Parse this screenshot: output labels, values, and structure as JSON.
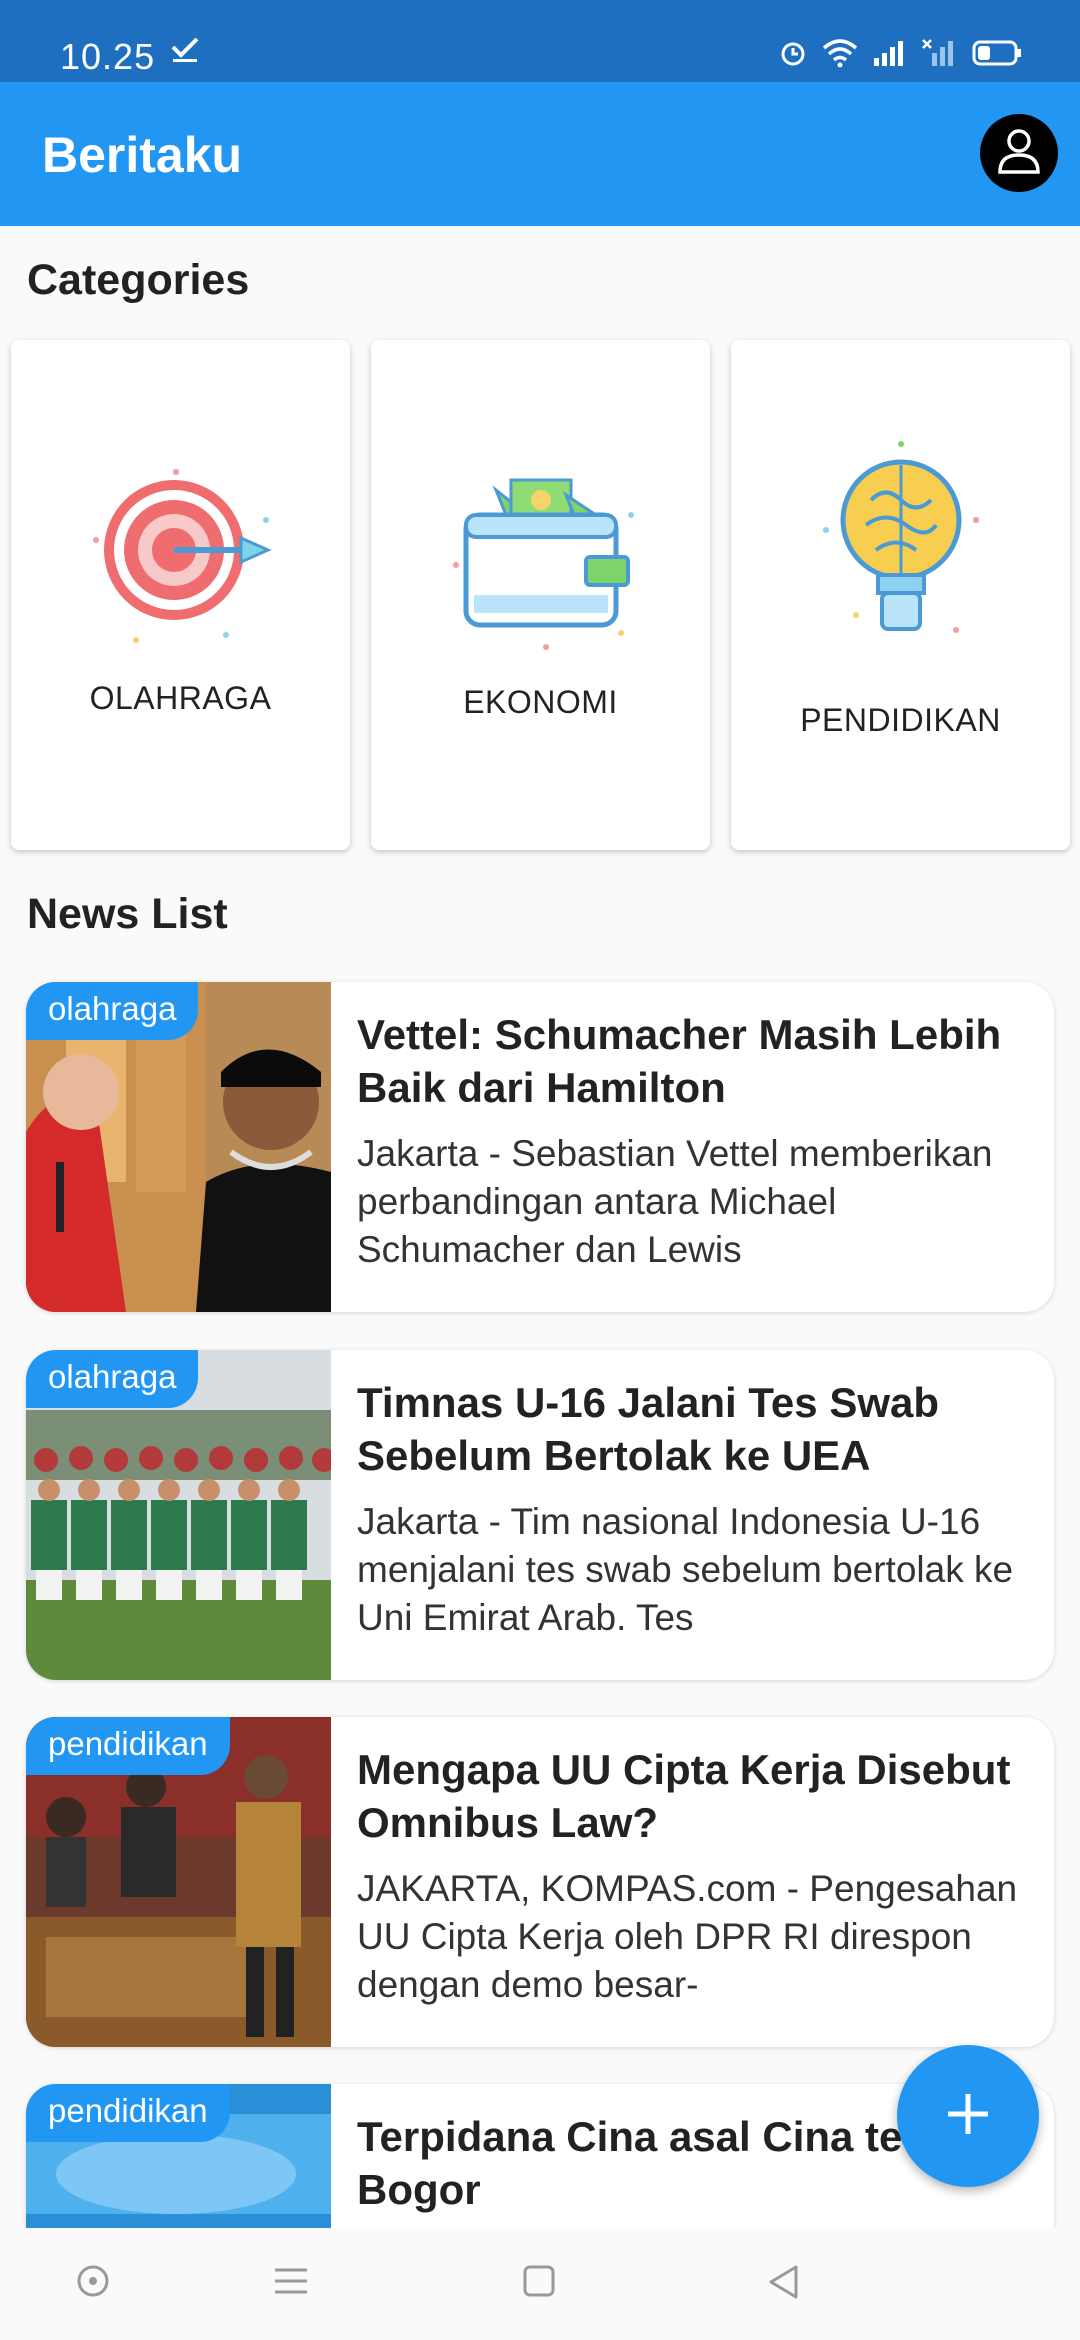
{
  "status_bar": {
    "time": "10.25"
  },
  "app_bar": {
    "title": "Beritaku"
  },
  "categories": {
    "title": "Categories",
    "items": [
      {
        "label": "OLAHRAGA",
        "icon": "target-icon"
      },
      {
        "label": "EKONOMI",
        "icon": "wallet-icon"
      },
      {
        "label": "PENDIDIKAN",
        "icon": "lightbulb-brain-icon"
      }
    ]
  },
  "news": {
    "title": "News List",
    "items": [
      {
        "tag": "olahraga",
        "title": "Vettel: Schumacher Masih Lebih Baik dari Hamilton",
        "body": "Jakarta - Sebastian Vettel memberikan perbandingan antara Michael Schumacher dan Lewis"
      },
      {
        "tag": "olahraga",
        "title": "Timnas U-16 Jalani Tes Swab Sebelum Bertolak ke UEA",
        "body": "Jakarta - Tim nasional Indonesia U-16 menjalani tes swab sebelum bertolak ke Uni Emirat Arab. Tes"
      },
      {
        "tag": "pendidikan",
        "title": "Mengapa UU Cipta Kerja Disebut Omnibus Law?",
        "body": "JAKARTA, KOMPAS.com - Pengesahan UU Cipta Kerja oleh DPR RI direspon dengan demo besar-"
      },
      {
        "tag": "pendidikan",
        "title": "Terpidana Cina asal Cina te di Bogor",
        "body": ""
      }
    ]
  },
  "colors": {
    "primary": "#2196f3",
    "status_bar": "#1e6fbf"
  }
}
